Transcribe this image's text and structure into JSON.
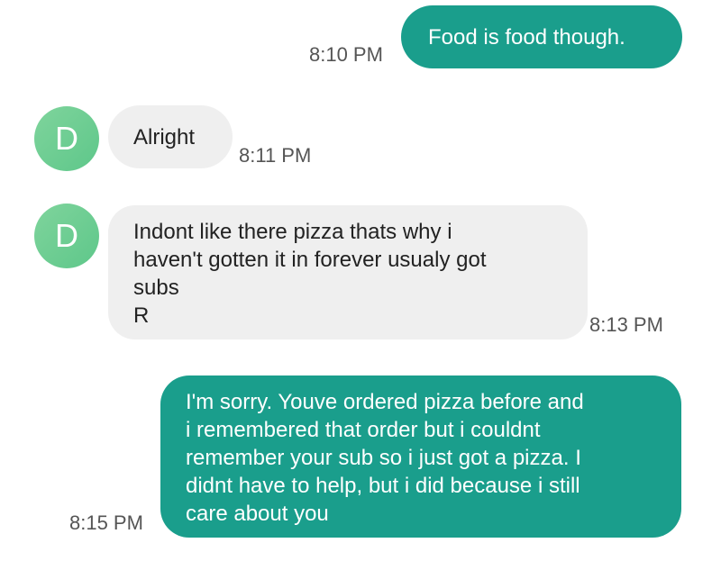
{
  "conversation": {
    "contact_initial": "D",
    "messages": [
      {
        "direction": "sent",
        "text": "Food is food though.",
        "time": "8:10 PM"
      },
      {
        "direction": "received",
        "text": "Alright",
        "time": "8:11 PM"
      },
      {
        "direction": "received",
        "text": "Indont like there pizza thats why i\nhaven't gotten it in forever usualy got\nsubs\nR",
        "time": "8:13 PM"
      },
      {
        "direction": "sent",
        "text": "I'm sorry. Youve ordered pizza before and\ni remembered that order but i couldnt\nremember your sub so i just got a pizza. I\ndidnt have to help, but i did because i still\ncare about you",
        "time": "8:15 PM"
      }
    ]
  },
  "colors": {
    "sent_bubble": "#1a9e8c",
    "received_bubble": "#efefef",
    "avatar": "#6ccb91"
  }
}
